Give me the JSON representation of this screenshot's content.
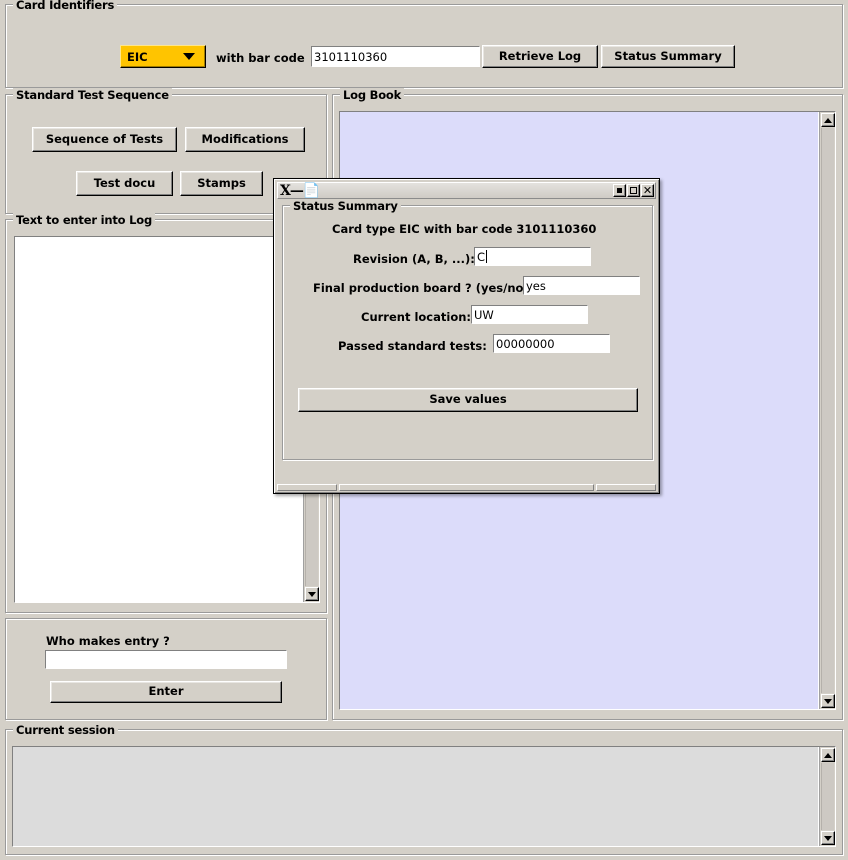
{
  "card_identifiers": {
    "title": "Card Identifiers",
    "card_type_selected": "EIC",
    "card_type_options": [
      "EIC"
    ],
    "bar_code_label": "with bar code",
    "bar_code_value": "3101110360",
    "retrieve_log_label": "Retrieve Log",
    "status_summary_label": "Status Summary"
  },
  "standard_test_sequence": {
    "title": "Standard Test Sequence",
    "sequence_of_tests_label": "Sequence of Tests",
    "modifications_label": "Modifications",
    "test_docu_label": "Test docu",
    "stamps_label": "Stamps"
  },
  "text_to_enter": {
    "title": "Text to enter into Log",
    "value": ""
  },
  "who_makes_entry": {
    "label": "Who makes entry ?",
    "value": "",
    "enter_label": "Enter"
  },
  "log_book": {
    "title": "Log Book",
    "content": "",
    "background_color": "#dcdcfa"
  },
  "current_session": {
    "title": "Current session",
    "content": "",
    "background_color": "#dcdcdc"
  },
  "status_summary_dialog": {
    "window_icon": "x-window-logo",
    "titlebar_title": "",
    "minimize_label": "minimize",
    "maximize_label": "maximize",
    "close_label": "✕",
    "group_title": "Status Summary",
    "heading": "Card type EIC with bar code 3101110360",
    "fields": [
      {
        "label": "Revision (A, B, ...):",
        "value": "C"
      },
      {
        "label": "Final production board ? (yes/no)",
        "value": "yes"
      },
      {
        "label": "Current location:",
        "value": "UW"
      },
      {
        "label": "Passed standard tests:",
        "value": "00000000"
      }
    ],
    "save_button_label": "Save values"
  },
  "theme": {
    "face": "#d4d0c8",
    "accent_yellow": "#ffc400",
    "logbook_blue": "#dcdcfa"
  }
}
